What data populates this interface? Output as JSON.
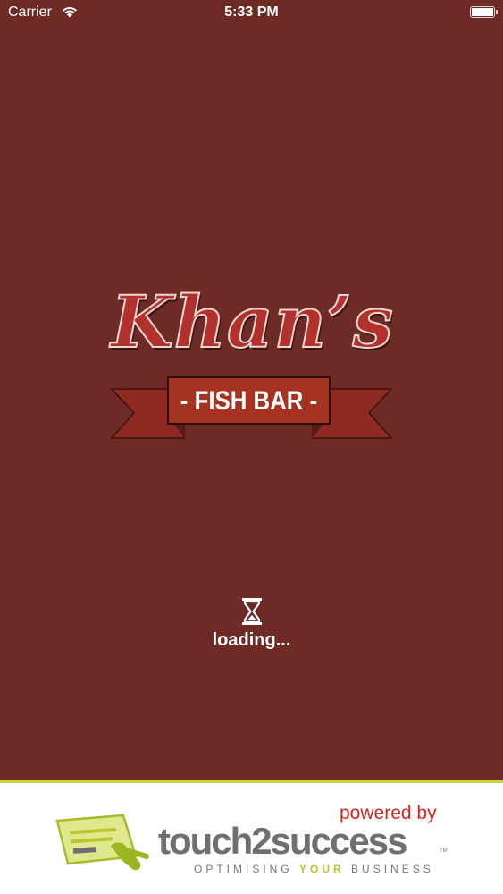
{
  "status_bar": {
    "carrier": "Carrier",
    "time": "5:33 PM",
    "icons": [
      "wifi-icon",
      "battery-icon"
    ]
  },
  "logo": {
    "script": "Khan’s",
    "banner": "- FISH BAR -"
  },
  "loading": {
    "icon": "hourglass-icon",
    "text": "loading..."
  },
  "footer": {
    "powered_by": "powered by",
    "brand": "touch2success",
    "trademark": "TM",
    "tagline_before": "OPTIMISING ",
    "tagline_accent": "YOUR",
    "tagline_after": " BUSINESS"
  },
  "colors": {
    "background": "#6e2a25",
    "banner": "#a63222",
    "accent_green": "#c6d63a",
    "powered_red": "#d2261e"
  }
}
